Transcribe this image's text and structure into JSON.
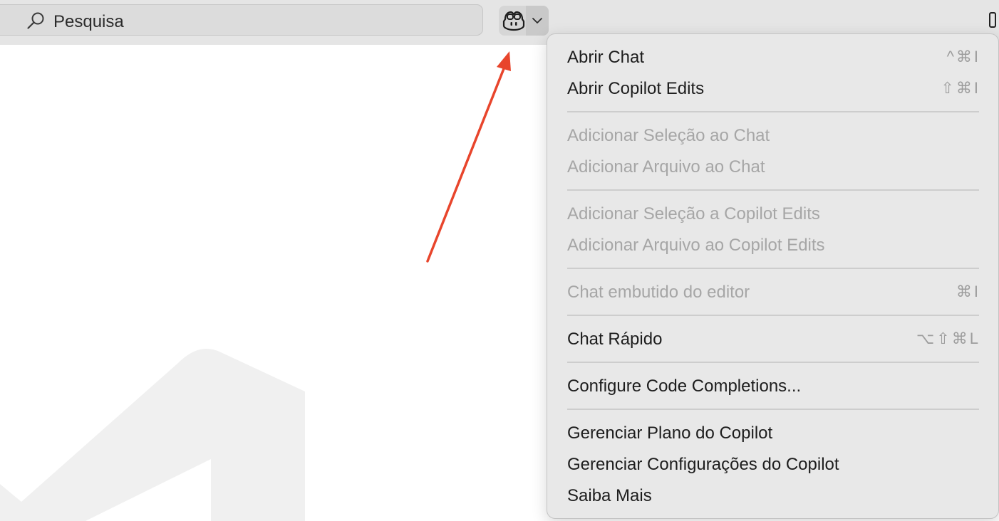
{
  "toolbar": {
    "search_placeholder": "Pesquisa"
  },
  "menu": {
    "items": [
      {
        "label": "Abrir Chat",
        "shortcut": "^⌘I",
        "enabled": true
      },
      {
        "label": "Abrir Copilot Edits",
        "shortcut": "⇧⌘I",
        "enabled": true
      },
      {
        "label": "Adicionar Seleção ao Chat",
        "shortcut": "",
        "enabled": false
      },
      {
        "label": "Adicionar Arquivo ao Chat",
        "shortcut": "",
        "enabled": false
      },
      {
        "label": "Adicionar Seleção a Copilot Edits",
        "shortcut": "",
        "enabled": false
      },
      {
        "label": "Adicionar Arquivo ao Copilot Edits",
        "shortcut": "",
        "enabled": false
      },
      {
        "label": "Chat embutido do editor",
        "shortcut": "⌘I",
        "enabled": false
      },
      {
        "label": "Chat Rápido",
        "shortcut": "⌥⇧⌘L",
        "enabled": true
      },
      {
        "label": "Configure Code Completions...",
        "shortcut": "",
        "enabled": true
      },
      {
        "label": "Gerenciar Plano do Copilot",
        "shortcut": "",
        "enabled": true
      },
      {
        "label": "Gerenciar Configurações do Copilot",
        "shortcut": "",
        "enabled": true
      },
      {
        "label": "Saiba Mais",
        "shortcut": "",
        "enabled": true
      }
    ]
  },
  "icons": {
    "search": "search-icon",
    "copilot": "copilot-icon",
    "chevron": "chevron-down-icon",
    "annotation_arrow": "red-arrow",
    "watermark": "vscode-logo-watermark"
  },
  "colors": {
    "arrow": "#e8452c",
    "menu_bg": "#e8e8e8",
    "disabled_text": "#a6a6a6"
  }
}
